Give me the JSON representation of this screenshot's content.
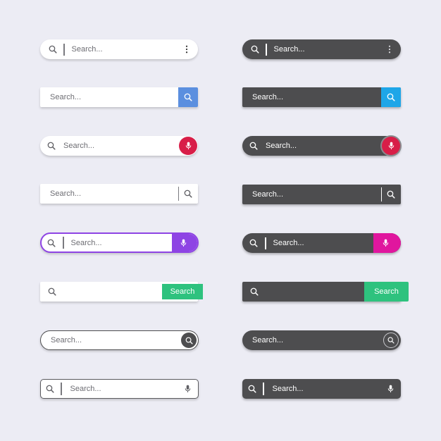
{
  "placeholder": "Search...",
  "button_label": "Search",
  "colors": {
    "light_bg": "#ffffff",
    "dark_bg": "#4d4d4f",
    "blue_accent": "#5b8fdf",
    "cyan_accent": "#1ea6e8",
    "red_mic": "#d81e48",
    "purple_accent": "#8e44e4",
    "magenta_accent": "#e0169e",
    "green_accent": "#2ec27e"
  },
  "icons": [
    "search-icon",
    "more-vert-icon",
    "microphone-icon"
  ],
  "bars": {
    "left": [
      {
        "style": "light-pill",
        "elements": [
          "search-icon",
          "divider",
          "input",
          "more-vert-icon"
        ]
      },
      {
        "style": "light-square",
        "elements": [
          "input",
          "search-button-blue"
        ]
      },
      {
        "style": "light-pill",
        "elements": [
          "search-icon",
          "input",
          "mic-button-red"
        ]
      },
      {
        "style": "light-square",
        "elements": [
          "input",
          "divider",
          "search-icon"
        ]
      },
      {
        "style": "light-pill-purple-border",
        "elements": [
          "search-icon",
          "divider",
          "input",
          "mic-button-purple"
        ]
      },
      {
        "style": "light-square",
        "elements": [
          "search-icon",
          "input",
          "search-text-button-green"
        ]
      },
      {
        "style": "light-pill-dark-border",
        "elements": [
          "input",
          "search-button-dark-circle"
        ]
      },
      {
        "style": "light-rounded-dark-border",
        "elements": [
          "search-icon",
          "divider",
          "input",
          "microphone-icon"
        ]
      }
    ],
    "right": [
      {
        "style": "dark-pill",
        "elements": [
          "search-icon",
          "divider",
          "input",
          "more-vert-icon"
        ]
      },
      {
        "style": "dark-square",
        "elements": [
          "input",
          "search-button-cyan"
        ]
      },
      {
        "style": "dark-pill",
        "elements": [
          "search-icon",
          "input",
          "mic-button-red-ring"
        ]
      },
      {
        "style": "dark-square",
        "elements": [
          "input",
          "divider",
          "search-icon"
        ]
      },
      {
        "style": "dark-pill",
        "elements": [
          "search-icon",
          "divider",
          "input",
          "mic-button-magenta"
        ]
      },
      {
        "style": "dark-square",
        "elements": [
          "search-icon",
          "input",
          "search-text-button-green"
        ]
      },
      {
        "style": "dark-pill",
        "elements": [
          "input",
          "search-button-outline-circle"
        ]
      },
      {
        "style": "dark-rounded",
        "elements": [
          "search-icon",
          "divider",
          "input",
          "microphone-icon"
        ]
      }
    ]
  }
}
